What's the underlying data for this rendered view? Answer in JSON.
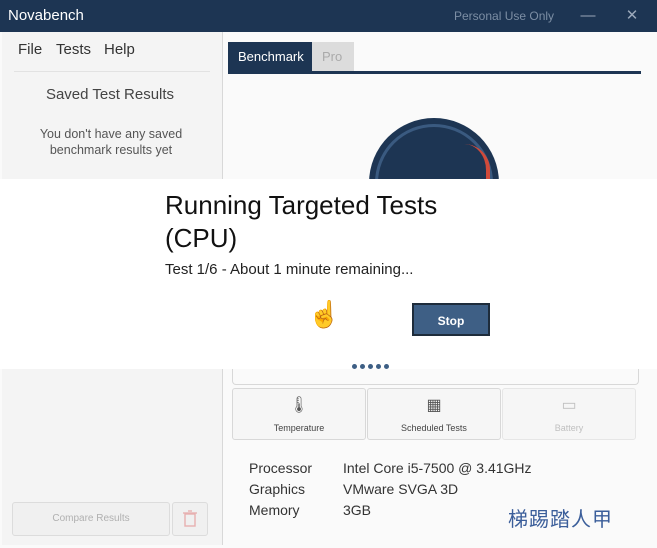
{
  "window": {
    "title": "Novabench",
    "license": "Personal Use Only",
    "minimize_glyph": "—",
    "close_glyph": "✕"
  },
  "menu": {
    "file": "File",
    "tests": "Tests",
    "help": "Help"
  },
  "saved": {
    "title": "Saved Test Results",
    "empty_message": "You don't have any saved benchmark results yet",
    "compare_label": "Compare Results",
    "trash_icon": "trash-icon"
  },
  "tabs": {
    "benchmark": "Benchmark",
    "pro": "Pro"
  },
  "actions": {
    "temperature": {
      "label": "Temperature",
      "icon": "thermometer-icon",
      "glyph": "🌡"
    },
    "scheduled": {
      "label": "Scheduled Tests",
      "icon": "calendar-icon",
      "glyph": "▦"
    },
    "battery": {
      "label": "Battery",
      "icon": "battery-icon",
      "glyph": "▭"
    }
  },
  "specs": [
    {
      "key": "Processor",
      "value": "Intel Core i5-7500 @ 3.41GHz"
    },
    {
      "key": "Graphics",
      "value": "VMware SVGA 3D"
    },
    {
      "key": "Memory",
      "value": "3GB"
    }
  ],
  "modal": {
    "title": "Running Targeted Tests (CPU)",
    "status": "Test 1/6 - About 1 minute remaining...",
    "stop_label": "Stop",
    "progress_dots": 5
  },
  "watermark": "梯踢踏人甲",
  "colors": {
    "accent": "#1d3553",
    "button": "#3e5f85",
    "gauge_red": "#d04a3a"
  }
}
